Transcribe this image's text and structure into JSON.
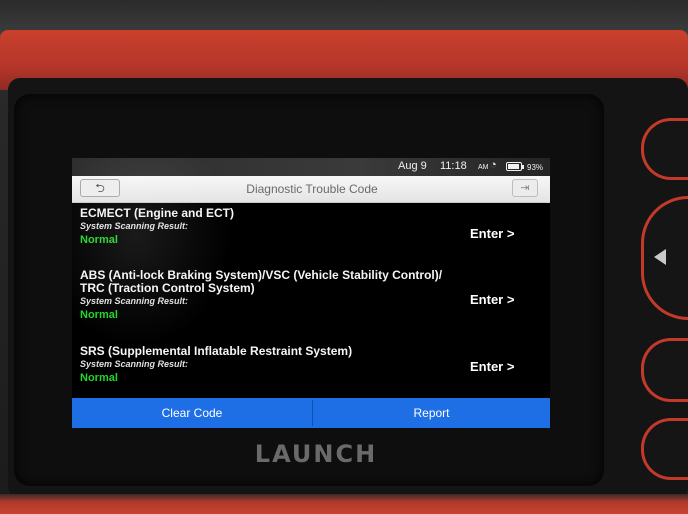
{
  "status_bar": {
    "date": "Aug 9",
    "time": "11:18",
    "ampm": "AM",
    "wifi_icon": "wifi-icon",
    "battery_percent": "93%",
    "battery_level": 0.93
  },
  "header": {
    "title": "Diagnostic Trouble Code",
    "back_icon": "back-arrow-icon",
    "exit_icon": "exit-icon"
  },
  "systems": [
    {
      "title_line1": "ECMECT (Engine and ECT)",
      "title_line2": "",
      "subtitle": "System Scanning Result:",
      "status": "Normal",
      "enter_label": "Enter >"
    },
    {
      "title_line1": "ABS (Anti-lock Braking System)/VSC (Vehicle Stability Control)/",
      "title_line2": "TRC (Traction Control System)",
      "subtitle": "System Scanning Result:",
      "status": "Normal",
      "enter_label": "Enter >"
    },
    {
      "title_line1": "SRS (Supplemental Inflatable Restraint System)",
      "title_line2": "",
      "subtitle": "System Scanning Result:",
      "status": "Normal",
      "enter_label": "Enter >"
    }
  ],
  "footer": {
    "clear_code_label": "Clear Code",
    "report_label": "Report"
  },
  "device": {
    "brand": "LAUNCH"
  },
  "colors": {
    "status_normal": "#23d42b",
    "action_bar": "#1e6fe6",
    "device_red": "#c43a2a"
  }
}
